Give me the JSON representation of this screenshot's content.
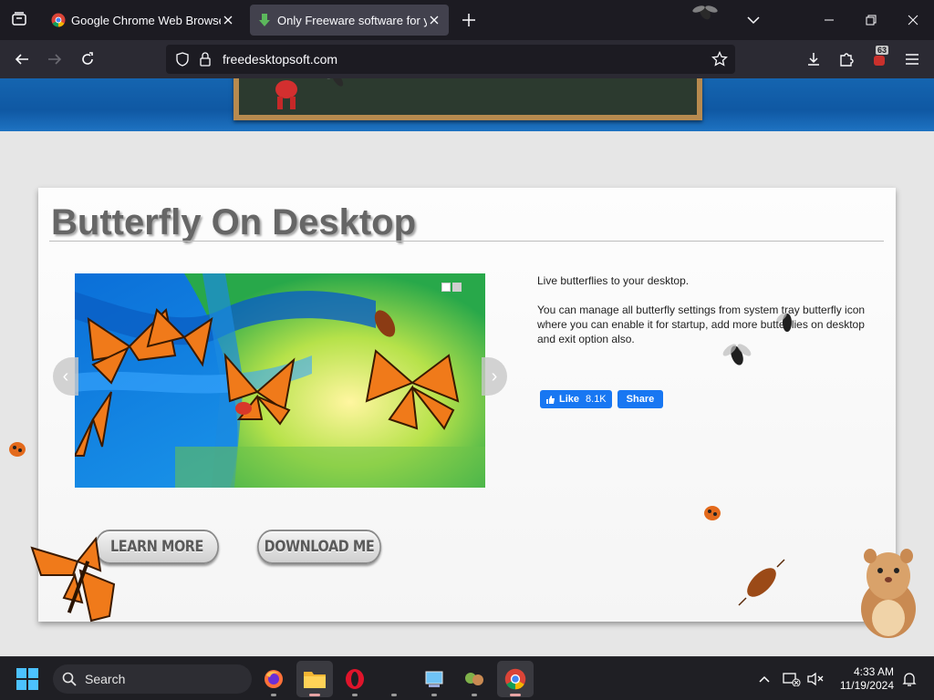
{
  "browser": {
    "tabs": [
      {
        "title": "Google Chrome Web Browser",
        "active": false
      },
      {
        "title": "Only Freeware software for you",
        "active": true
      }
    ],
    "url": "freedesktopsoft.com",
    "extension_badge": "63"
  },
  "page": {
    "title": "Butterfly On Desktop",
    "description": [
      "Live butterflies to your desktop.",
      "You can manage all butterfly settings from system tray butterfly icon where you can enable it for startup, add more butterflies on desktop and exit option also."
    ],
    "facebook": {
      "like_label": "Like",
      "like_count": "8.1K",
      "share_label": "Share"
    },
    "buttons": {
      "learn_more": "LEARN MORE",
      "download": "DOWNLOAD ME"
    }
  },
  "taskbar": {
    "search_label": "Search",
    "time": "4:33 AM",
    "date": "11/19/2024",
    "apps": [
      "firefox-icon",
      "file-explorer-icon",
      "opera-icon",
      "app-window-icon",
      "desktop-pet-icon",
      "chrome-icon"
    ]
  },
  "colors": {
    "tabbar": "#1c1b22",
    "navbar": "#2b2a33",
    "banner_blue": "#0f58a3",
    "facebook": "#1877f2",
    "taskbar": "#1f1f24"
  }
}
